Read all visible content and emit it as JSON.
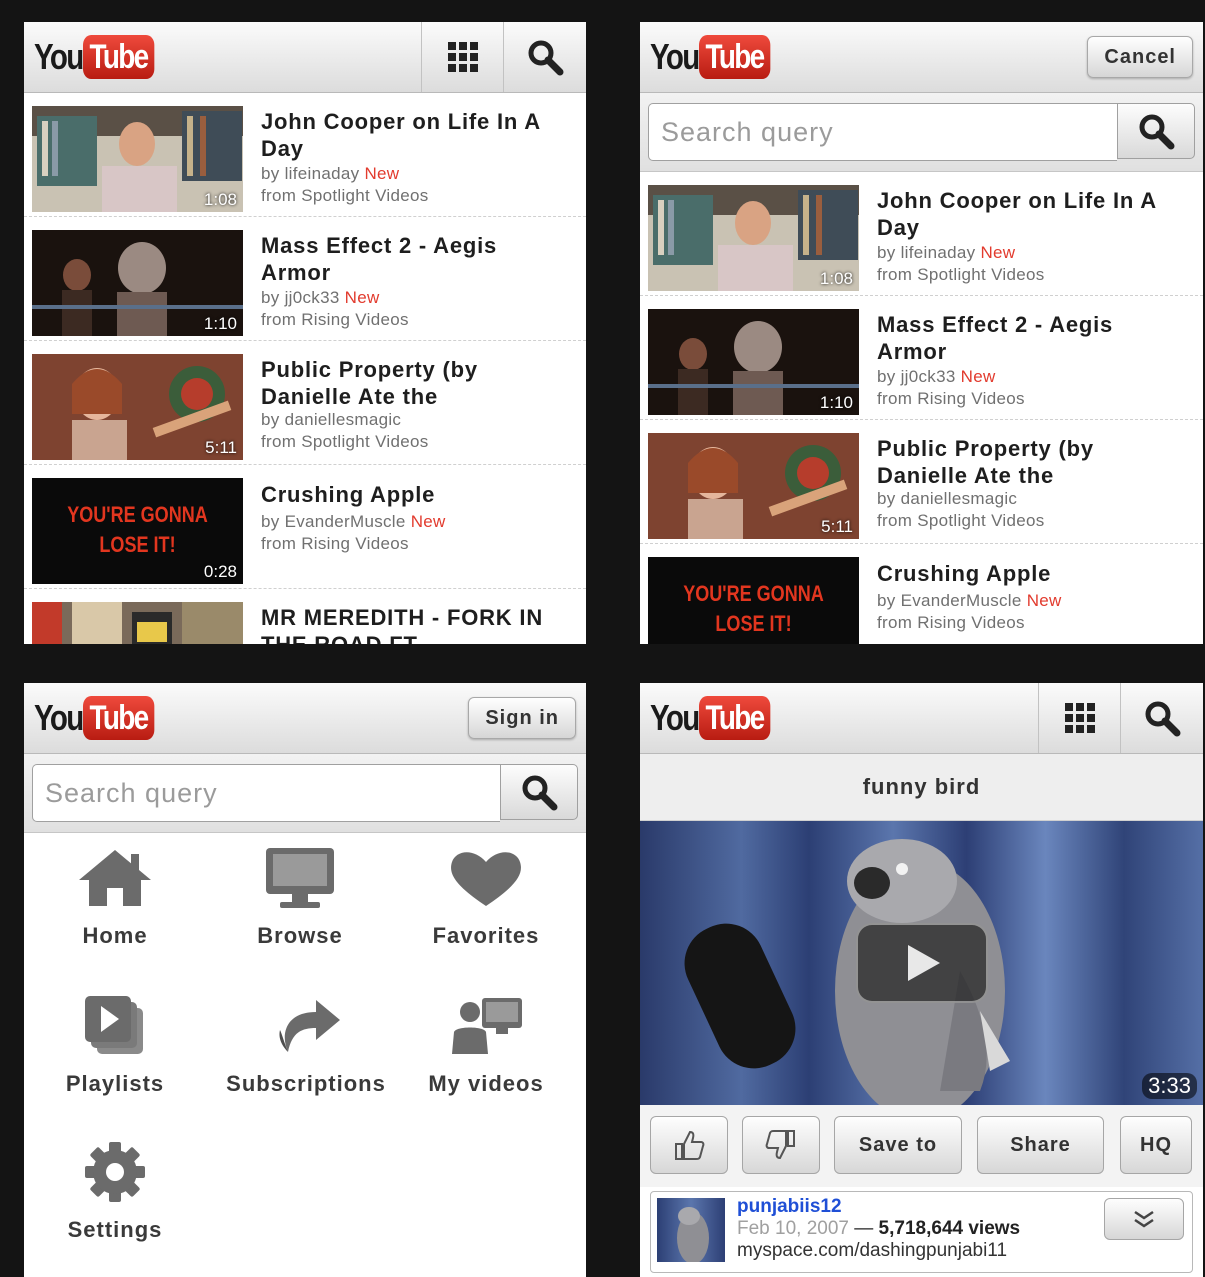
{
  "brand": {
    "you": "You",
    "tube": "Tube"
  },
  "videos": [
    {
      "title": "John Cooper on Life In A Day",
      "by": "by lifeinaday",
      "new": "New",
      "from": "from Spotlight Videos",
      "duration": "1:08"
    },
    {
      "title": "Mass Effect 2 - Aegis Armor",
      "by": "by jj0ck33",
      "new": "New",
      "from": "from Rising Videos",
      "duration": "1:10"
    },
    {
      "title": "Public Property (by Danielle Ate the",
      "by": "by daniellesmagic",
      "new": "",
      "from": "from Spotlight Videos",
      "duration": "5:11"
    },
    {
      "title": "Crushing Apple",
      "by": "by EvanderMuscle",
      "new": "New",
      "from": "from Rising Videos",
      "duration": "0:28",
      "thumb_text_1": "YOU'RE GONNA",
      "thumb_text_2": "LOSE IT!"
    },
    {
      "title": "MR MEREDITH - FORK IN THE ROAD FT",
      "by": "",
      "new": "",
      "from": "",
      "duration": ""
    }
  ],
  "search": {
    "placeholder": "Search query",
    "cancel_label": "Cancel",
    "signin_label": "Sign in"
  },
  "menu": {
    "items": [
      {
        "label": "Home",
        "icon": "home-icon"
      },
      {
        "label": "Browse",
        "icon": "monitor-icon"
      },
      {
        "label": "Favorites",
        "icon": "heart-icon"
      },
      {
        "label": "Playlists",
        "icon": "playlists-icon"
      },
      {
        "label": "Subscriptions",
        "icon": "share-arrow-icon"
      },
      {
        "label": "My videos",
        "icon": "user-computer-icon"
      },
      {
        "label": "Settings",
        "icon": "gear-icon"
      }
    ]
  },
  "watch": {
    "title": "funny bird",
    "duration": "3:33",
    "save_label": "Save to",
    "share_label": "Share",
    "hq_label": "HQ",
    "uploader": "punjabiis12",
    "date": "Feb 10, 2007",
    "dash": "—",
    "views": "5,718,644 views",
    "link": "myspace.com/dashingpunjabi11"
  },
  "colors": {
    "accent_red": "#e23b2e",
    "link_blue": "#1f4fd6"
  }
}
